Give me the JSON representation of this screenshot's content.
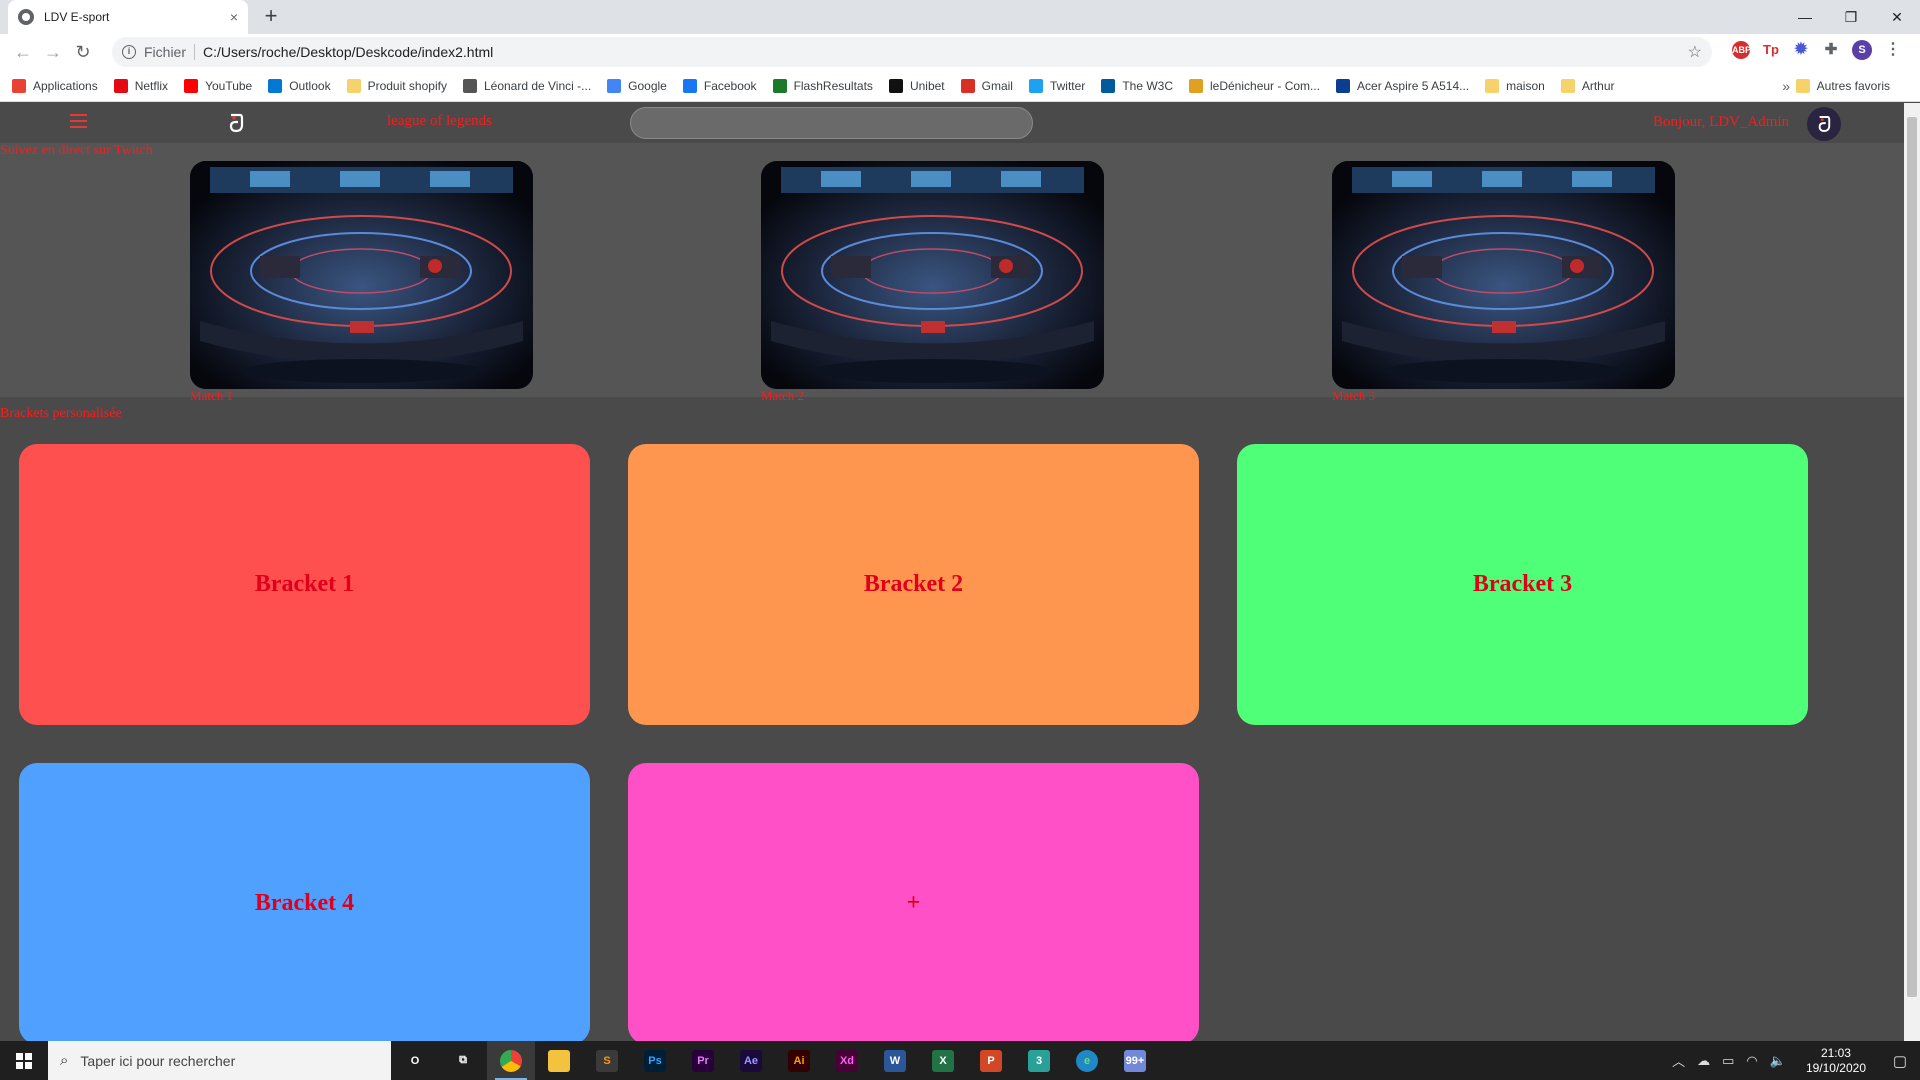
{
  "browser": {
    "tab_title": "LDV E-sport",
    "tab_close": "×",
    "new_tab": "+",
    "url_scheme": "Fichier",
    "url": "C:/Users/roche/Desktop/Deskcode/index2.html",
    "bookmarks": [
      {
        "label": "Applications",
        "icon": "apps-grid-icon",
        "color": "#e94235"
      },
      {
        "label": "Netflix",
        "icon": "netflix-icon",
        "color": "#e50914"
      },
      {
        "label": "YouTube",
        "icon": "youtube-icon",
        "color": "#ff0000"
      },
      {
        "label": "Outlook",
        "icon": "outlook-icon",
        "color": "#0078d4"
      },
      {
        "label": "Produit shopify",
        "icon": "folder-icon",
        "color": "#f6d36a"
      },
      {
        "label": "Léonard de Vinci -...",
        "icon": "ldv-icon",
        "color": "#555555"
      },
      {
        "label": "Google",
        "icon": "google-icon",
        "color": "#4285f4"
      },
      {
        "label": "Facebook",
        "icon": "facebook-icon",
        "color": "#1877f2"
      },
      {
        "label": "FlashResultats",
        "icon": "flashresultats-icon",
        "color": "#1a7a2a"
      },
      {
        "label": "Unibet",
        "icon": "unibet-icon",
        "color": "#111111"
      },
      {
        "label": "Gmail",
        "icon": "gmail-icon",
        "color": "#d93025"
      },
      {
        "label": "Twitter",
        "icon": "twitter-icon",
        "color": "#1da1f2"
      },
      {
        "label": "The W3C",
        "icon": "w3c-icon",
        "color": "#005a9c"
      },
      {
        "label": "leDénicheur - Com...",
        "icon": "ledenicheur-icon",
        "color": "#e0a020"
      },
      {
        "label": "Acer Aspire 5 A514...",
        "icon": "ldlc-icon",
        "color": "#0b3d91"
      },
      {
        "label": "maison",
        "icon": "folder-icon",
        "color": "#f6d36a"
      },
      {
        "label": "Arthur",
        "icon": "folder-icon",
        "color": "#f6d36a"
      }
    ],
    "more_bookmarks": "»",
    "other_bookmarks": "Autres favoris",
    "profile_initial": "S"
  },
  "header": {
    "game": "league of legends",
    "greeting": "Bonjour, LDV_Admin"
  },
  "twitch": {
    "title": "Suivez en direct sur Twitch",
    "streams": [
      {
        "label": "Match 1"
      },
      {
        "label": "Match 2"
      },
      {
        "label": "Match 3"
      }
    ]
  },
  "brackets": {
    "title": "Brackets personalisée",
    "items": [
      {
        "label": "Bracket 1",
        "color": "#ff5050"
      },
      {
        "label": "Bracket 2",
        "color": "#ff9650"
      },
      {
        "label": "Bracket 3",
        "color": "#50ff78"
      },
      {
        "label": "Bracket 4",
        "color": "#50a0ff"
      },
      {
        "label": "+",
        "color": "#ff50c8"
      }
    ]
  },
  "taskbar": {
    "search_placeholder": "Taper ici pour rechercher",
    "apps": [
      {
        "name": "cortana",
        "label": "O"
      },
      {
        "name": "task-view",
        "label": "⧉"
      },
      {
        "name": "chrome",
        "label": "",
        "active": true
      },
      {
        "name": "file-explorer",
        "label": ""
      },
      {
        "name": "sublime",
        "label": "S"
      },
      {
        "name": "photoshop",
        "label": "Ps"
      },
      {
        "name": "premiere",
        "label": "Pr"
      },
      {
        "name": "after-effects",
        "label": "Ae"
      },
      {
        "name": "illustrator",
        "label": "Ai"
      },
      {
        "name": "xd",
        "label": "Xd"
      },
      {
        "name": "word",
        "label": "W"
      },
      {
        "name": "excel",
        "label": "X"
      },
      {
        "name": "powerpoint",
        "label": "P"
      },
      {
        "name": "app-3",
        "label": "3"
      },
      {
        "name": "edge",
        "label": "e"
      },
      {
        "name": "discord",
        "label": "99+"
      }
    ],
    "time": "21:03",
    "date": "19/10/2020"
  }
}
